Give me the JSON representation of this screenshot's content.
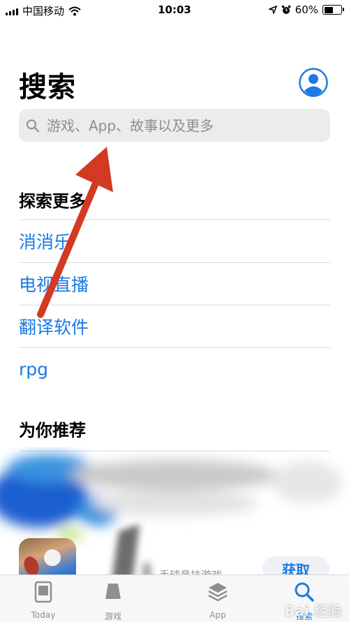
{
  "status_bar": {
    "carrier": "中国移动",
    "time": "10:03",
    "battery": "60%",
    "battery_level": 0.6
  },
  "header": {
    "title": "搜索"
  },
  "search": {
    "placeholder": "游戏、App、故事以及更多"
  },
  "discover": {
    "title": "探索更多",
    "items": [
      "消消乐",
      "电视直播",
      "翻译软件",
      "rpg"
    ]
  },
  "recommended": {
    "title": "为你推荐",
    "app_subtitle": "手球竞技游戏",
    "get_label": "获取"
  },
  "tabbar": {
    "tabs": [
      {
        "label": "Today",
        "icon": "today-icon"
      },
      {
        "label": "游戏",
        "icon": "games-icon"
      },
      {
        "label": "App",
        "icon": "apps-icon"
      },
      {
        "label": "",
        "icon": "arcade-icon"
      },
      {
        "label": "搜索",
        "icon": "search-icon"
      }
    ],
    "active": "搜索"
  },
  "watermark": "Bai 经验",
  "colors": {
    "accent": "#1b7ae5",
    "annotation_arrow": "#d23a22"
  }
}
